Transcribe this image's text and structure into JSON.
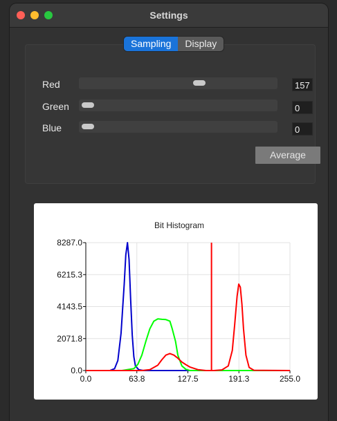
{
  "window": {
    "title": "Settings"
  },
  "tabs": [
    {
      "label": "Sampling",
      "active": true
    },
    {
      "label": "Display",
      "active": false
    }
  ],
  "sliders": [
    {
      "label": "Red",
      "value": "157",
      "fraction": 0.616
    },
    {
      "label": "Green",
      "value": "0",
      "fraction": 0.0
    },
    {
      "label": "Blue",
      "value": "0",
      "fraction": 0.0
    }
  ],
  "average_label": "Average",
  "colors": {
    "accent": "#1a73d9",
    "red": "#ff0000",
    "green": "#00ff00",
    "blue": "#0000cc"
  },
  "chart_data": {
    "type": "line",
    "title": "Bit Histogram",
    "xlim": [
      0,
      255
    ],
    "ylim": [
      0,
      8287
    ],
    "x_ticks": [
      "0.0",
      "63.8",
      "127.5",
      "191.3",
      "255.0"
    ],
    "y_ticks": [
      "0.0",
      "2071.8",
      "4143.5",
      "6215.3",
      "8287.0"
    ],
    "marker_x": 157,
    "grid": true,
    "series": [
      {
        "color": "#0000cc",
        "x": [
          0,
          30,
          36,
          40,
          44,
          48,
          50,
          52,
          54,
          56,
          58,
          60,
          62,
          66,
          72,
          255
        ],
        "y": [
          0,
          0,
          120,
          650,
          2400,
          5600,
          7500,
          8287,
          7200,
          4600,
          2300,
          900,
          300,
          60,
          0,
          0
        ]
      },
      {
        "color": "#00ff00",
        "x": [
          0,
          45,
          60,
          65,
          70,
          75,
          80,
          85,
          90,
          95,
          100,
          105,
          108,
          112,
          115,
          120,
          125,
          130,
          255
        ],
        "y": [
          0,
          0,
          120,
          400,
          1000,
          1900,
          2700,
          3200,
          3350,
          3320,
          3300,
          3200,
          2700,
          1900,
          1000,
          300,
          80,
          0,
          0
        ]
      },
      {
        "color": "#ff0000",
        "x": [
          0,
          70,
          80,
          90,
          95,
          100,
          105,
          110,
          115,
          120,
          125,
          130,
          140,
          150,
          160,
          170,
          178,
          183,
          186,
          189,
          191,
          193,
          195,
          197,
          200,
          204,
          210,
          255
        ],
        "y": [
          0,
          0,
          60,
          350,
          700,
          1000,
          1100,
          1000,
          800,
          550,
          380,
          230,
          60,
          0,
          0,
          40,
          300,
          1300,
          3000,
          4800,
          5600,
          5400,
          4300,
          2700,
          1000,
          200,
          20,
          0
        ]
      }
    ]
  }
}
